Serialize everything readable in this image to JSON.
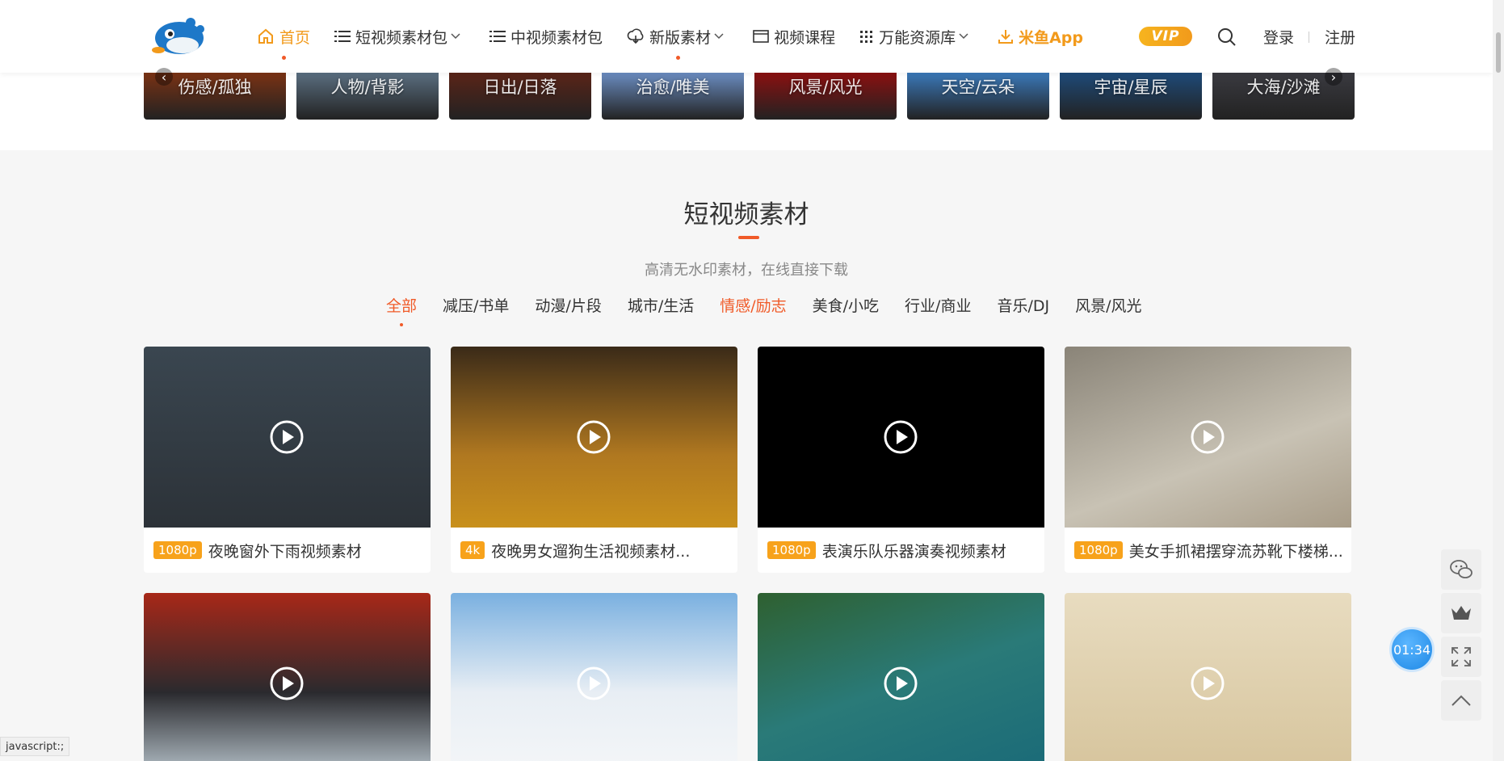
{
  "header": {
    "nav": [
      {
        "label": "首页",
        "icon": "home-icon",
        "active": true
      },
      {
        "label": "短视频素材包",
        "icon": "list-icon",
        "dropdown": true
      },
      {
        "label": "中视频素材包",
        "icon": "list-icon"
      },
      {
        "label": "新版素材",
        "icon": "cloud-icon",
        "dropdown": true
      },
      {
        "label": "视频课程",
        "icon": "video-icon"
      },
      {
        "label": "万能资源库",
        "icon": "grid-icon",
        "dropdown": true
      },
      {
        "label": "米鱼App",
        "icon": "download-icon"
      }
    ],
    "vip_label": "VIP",
    "login_label": "登录",
    "register_label": "注册"
  },
  "category_strip": [
    {
      "label": "伤感/孤独",
      "color": "#7a3214"
    },
    {
      "label": "人物/背影",
      "color": "#5a6e80"
    },
    {
      "label": "日出/日落",
      "color": "#5a2418"
    },
    {
      "label": "治愈/唯美",
      "color": "#6a8cc0"
    },
    {
      "label": "风景/风光",
      "color": "#8a1010"
    },
    {
      "label": "天空/云朵",
      "color": "#3a78b8"
    },
    {
      "label": "宇宙/星辰",
      "color": "#1e4a78"
    },
    {
      "label": "大海/沙滩",
      "color": "#3a3a40"
    }
  ],
  "section": {
    "title": "短视频素材",
    "subtitle": "高清无水印素材，在线直接下载"
  },
  "tabs": [
    {
      "label": "全部",
      "active": true
    },
    {
      "label": "减压/书单"
    },
    {
      "label": "动漫/片段"
    },
    {
      "label": "城市/生活"
    },
    {
      "label": "情感/励志",
      "accent": true
    },
    {
      "label": "美食/小吃"
    },
    {
      "label": "行业/商业"
    },
    {
      "label": "音乐/DJ"
    },
    {
      "label": "风景/风光"
    }
  ],
  "videos": [
    {
      "badge": "1080p",
      "title": "夜晚窗外下雨视频素材",
      "bg": "linear-gradient(180deg,#3a4650,#2c3238)"
    },
    {
      "badge": "4k",
      "title": "夜晚男女遛狗生活视频素材...",
      "bg": "linear-gradient(180deg,#3a2a18,#b07820 60%,#c8901c)"
    },
    {
      "badge": "1080p",
      "title": "表演乐队乐器演奏视频素材",
      "bg": "#000000"
    },
    {
      "badge": "1080p",
      "title": "美女手抓裙摆穿流苏靴下楼梯...",
      "bg": "linear-gradient(160deg,#8a8478,#c8c2b4 60%,#a89c88)"
    },
    {
      "badge": "",
      "title": "",
      "bg": "linear-gradient(180deg,#a82818,#2a2a2e 55%,#b4c0c8)"
    },
    {
      "badge": "",
      "title": "",
      "bg": "linear-gradient(180deg,#7ab0e0,#e8eef4 55%,#f4f6f8)"
    },
    {
      "badge": "",
      "title": "",
      "bg": "linear-gradient(160deg,#2e6030,#2a7a78 50%,#1a6a78)"
    },
    {
      "badge": "",
      "title": "",
      "bg": "linear-gradient(180deg,#e8dcc0,#d6c49c)"
    }
  ],
  "timer": "01:34",
  "status_url": "javascript:;"
}
